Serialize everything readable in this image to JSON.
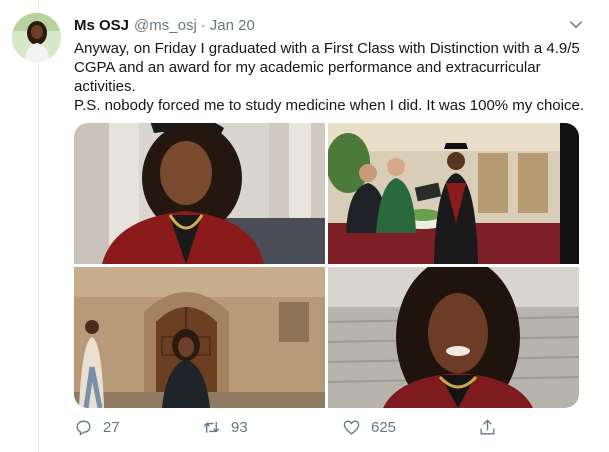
{
  "tweet": {
    "author_name": "Ms OSJ",
    "author_handle": "@ms_osj",
    "separator": "·",
    "date": "Jan 20",
    "text_line1": "Anyway, on Friday I graduated with a First Class with Distinction with a 4.9/5 CGPA and an award for my academic performance and extracurricular activities.",
    "text_line2": "P.S. nobody forced me to study medicine when I did. It was 100% my choice.",
    "reply_count": "27",
    "retweet_count": "93",
    "like_count": "625"
  },
  "icons": {
    "more": "chevron-down-icon",
    "reply": "reply-icon",
    "retweet": "retweet-icon",
    "like": "heart-icon",
    "share": "share-icon"
  },
  "colors": {
    "text": "#14171a",
    "secondary": "#657786",
    "divider": "#e6ecf0",
    "gown_red": "#8b1a1a"
  }
}
